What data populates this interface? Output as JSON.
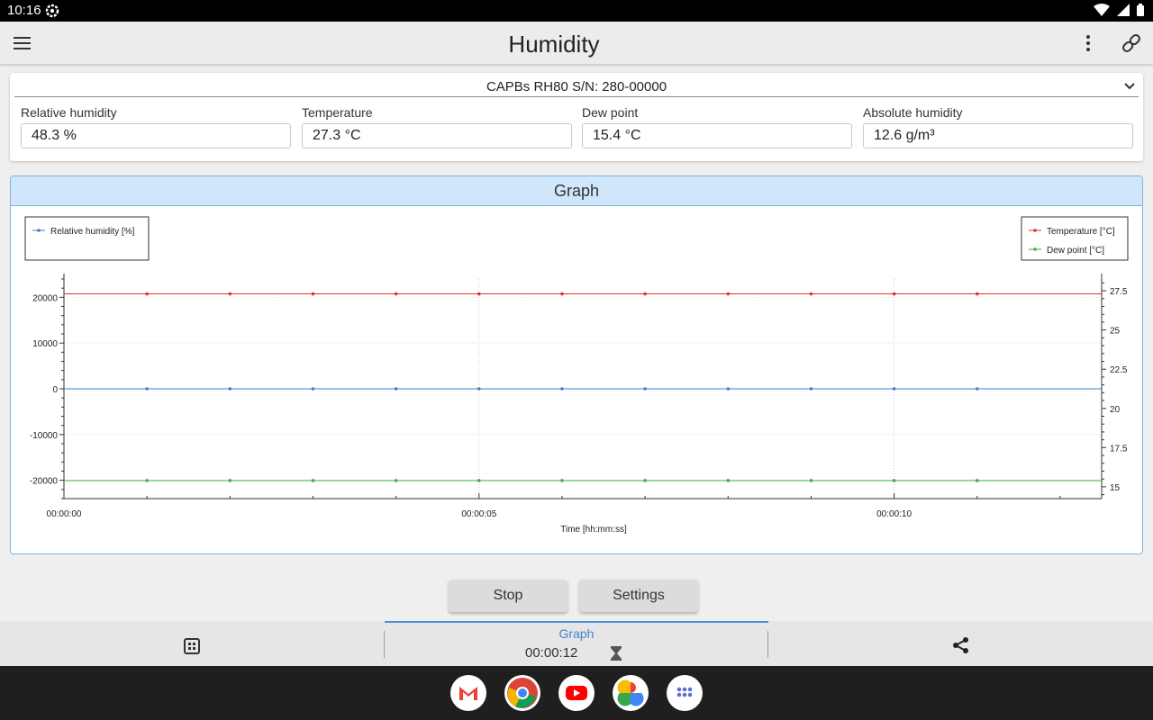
{
  "status_bar": {
    "time": "10:16"
  },
  "app_bar": {
    "title": "Humidity"
  },
  "device": {
    "name": "CAPBs RH80 S/N: 280-00000"
  },
  "readings": [
    {
      "label": "Relative humidity",
      "value": "48.3 %"
    },
    {
      "label": "Temperature",
      "value": "27.3 °C"
    },
    {
      "label": "Dew point",
      "value": "15.4 °C"
    },
    {
      "label": "Absolute humidity",
      "value": "12.6 g/m³"
    }
  ],
  "graph": {
    "header": "Graph"
  },
  "chart_data": {
    "type": "line",
    "x": [
      "00:00:01",
      "00:00:02",
      "00:00:03",
      "00:00:04",
      "00:00:05",
      "00:00:06",
      "00:00:07",
      "00:00:08",
      "00:00:09",
      "00:00:10",
      "00:00:11"
    ],
    "x_tick_labels": [
      "00:00:00",
      "00:00:05",
      "00:00:10"
    ],
    "xlabel": "Time [hh:mm:ss]",
    "xlim": [
      0,
      12.5
    ],
    "y_left": {
      "ylim": [
        -24000,
        24000
      ],
      "ticks": [
        "20000",
        "10000",
        "0",
        "-10000",
        "-20000"
      ]
    },
    "y_right": {
      "ylim": [
        14.25,
        28.25
      ],
      "ticks": [
        "27.5",
        "25",
        "22.5",
        "20",
        "17.5",
        "15"
      ]
    },
    "series": [
      {
        "name": "Relative humidity [%]",
        "axis": "left",
        "color": "#3b82c4",
        "values": [
          0,
          0,
          0,
          0,
          0,
          0,
          0,
          0,
          0,
          0,
          0
        ]
      },
      {
        "name": "Temperature [°C]",
        "axis": "right",
        "color": "#e0312e",
        "values": [
          27.3,
          27.3,
          27.3,
          27.3,
          27.3,
          27.3,
          27.3,
          27.3,
          27.3,
          27.3,
          27.3
        ]
      },
      {
        "name": "Dew point [°C]",
        "axis": "right",
        "color": "#3bb040",
        "values": [
          15.4,
          15.4,
          15.4,
          15.4,
          15.4,
          15.4,
          15.4,
          15.4,
          15.4,
          15.4,
          15.4
        ]
      }
    ],
    "legend_left": [
      "Relative humidity [%]"
    ],
    "legend_right": [
      "Temperature [°C]",
      "Dew point [°C]"
    ],
    "grid": true
  },
  "controls": {
    "stop_label": "Stop",
    "settings_label": "Settings"
  },
  "tabbar": {
    "graph_label": "Graph",
    "elapsed": "00:00:12"
  },
  "icons": {
    "menu": "menu-icon",
    "more": "more-vert-icon",
    "link": "link-icon",
    "dashboard": "dashboard-icon",
    "share": "share-icon",
    "hourglass": "hourglass-icon"
  }
}
